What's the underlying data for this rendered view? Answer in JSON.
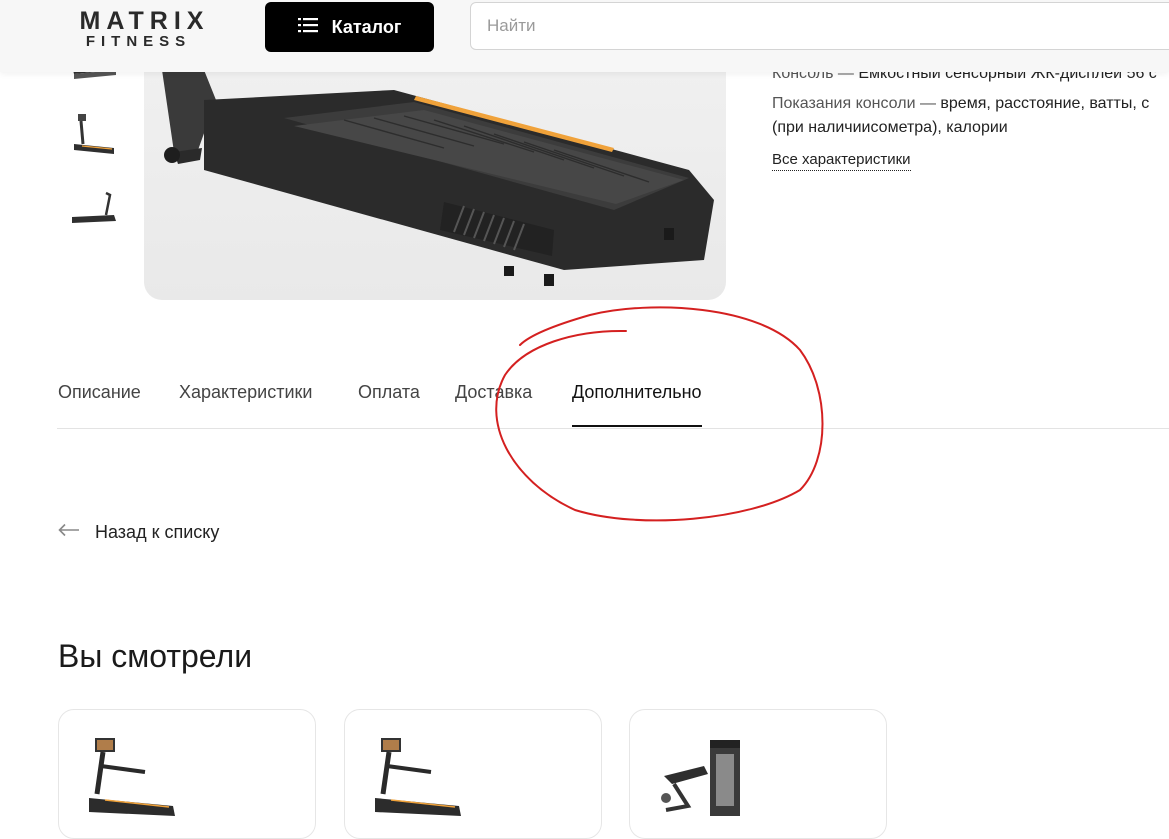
{
  "header": {
    "logo_top": "MATRIX",
    "logo_bottom": "FITNESS",
    "catalog_label": "Каталог",
    "catalog_icon": "list-icon",
    "search_placeholder": "Найти",
    "search_value": ""
  },
  "gallery": {
    "thumbnails": [
      "treadmill-thumb",
      "treadmill-thumb",
      "treadmill-side-thumb"
    ],
    "main_image": "treadmill-deck-image"
  },
  "specs": {
    "line1_key": "Консоль —",
    "line1_value": "Емкостный сенсорный ЖК-дисплей 56 с",
    "line2_key": "Показания консоли —",
    "line2_value": "время, расстояние, ватты, с",
    "line3": "(при наличиисометра), калории",
    "all_link": "Все характеристики"
  },
  "tabs": [
    {
      "label": "Описание",
      "active": false
    },
    {
      "label": "Характеристики",
      "active": false
    },
    {
      "label": "Оплата",
      "active": false
    },
    {
      "label": "Доставка",
      "active": false
    },
    {
      "label": "Дополнительно",
      "active": true
    }
  ],
  "back_link": {
    "label": "Назад к списку",
    "icon": "arrow-left-icon"
  },
  "viewed": {
    "title": "Вы смотрели",
    "cards": [
      {
        "image": "treadmill-product-image"
      },
      {
        "image": "treadmill-product-image"
      },
      {
        "image": "strength-machine-product-image"
      }
    ]
  },
  "colors": {
    "accent": "#000000",
    "annotation": "#d42020",
    "treadmill_stripe": "#f0a23a"
  }
}
